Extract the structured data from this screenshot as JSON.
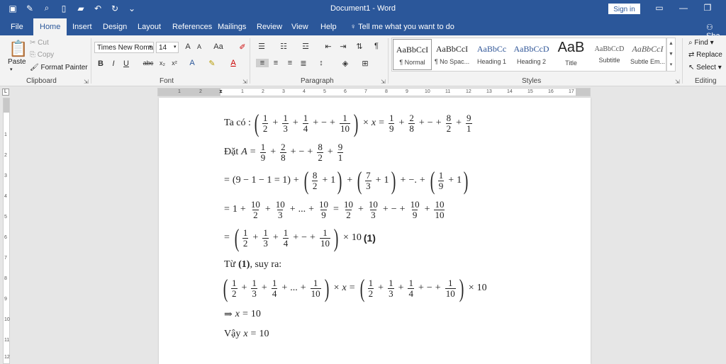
{
  "window": {
    "title": "Document1 - Word",
    "signin_label": "Sign in",
    "share_label": "Sha",
    "tell_me": "Tell me what you want to do"
  },
  "tabs": [
    "File",
    "Home",
    "Insert",
    "Design",
    "Layout",
    "References",
    "Mailings",
    "Review",
    "View",
    "Help"
  ],
  "active_tab": "Home",
  "clipboard": {
    "label": "Clipboard",
    "paste": "Paste",
    "cut": "Cut",
    "copy": "Copy",
    "format_painter": "Format Painter"
  },
  "font": {
    "label": "Font",
    "name": "Times New Roma",
    "size": "14"
  },
  "paragraph": {
    "label": "Paragraph"
  },
  "styles": {
    "label": "Styles",
    "items": [
      {
        "sample": "AaBbCcI",
        "name": "¶ Normal"
      },
      {
        "sample": "AaBbCcI",
        "name": "¶ No Spac..."
      },
      {
        "sample": "AaBbCc",
        "name": "Heading 1"
      },
      {
        "sample": "AaBbCcD",
        "name": "Heading 2"
      },
      {
        "sample": "AaB",
        "name": "Title"
      },
      {
        "sample": "AaBbCcD",
        "name": "Subtitle"
      },
      {
        "sample": "AaBbCcI",
        "name": "Subtle Em..."
      }
    ]
  },
  "editing": {
    "label": "Editing",
    "find": "Find",
    "replace": "Replace",
    "select": "Select"
  },
  "ruler_h": [
    "1",
    "2",
    "1",
    "1",
    "2",
    "3",
    "4",
    "5",
    "6",
    "7",
    "8",
    "9",
    "10",
    "11",
    "12",
    "13",
    "14",
    "15",
    "16",
    "17"
  ],
  "ruler_v": [
    "1",
    "2",
    "3",
    "4",
    "5",
    "6",
    "7",
    "8",
    "9",
    "10",
    "11",
    "12",
    "13"
  ],
  "doc": {
    "line1_prefix": "Ta có :",
    "line2_prefix": "Đặt",
    "line6_text": "Từ",
    "line6_mark": "(1)",
    "line6_suffix": ", suy ra:",
    "line5_mark": "(1)",
    "line9_prefix": "Vậy",
    "result": "10"
  },
  "colors": {
    "accent": "#2b579a",
    "ribbon": "#f3f3f3",
    "canvas": "#e6e6e6"
  }
}
